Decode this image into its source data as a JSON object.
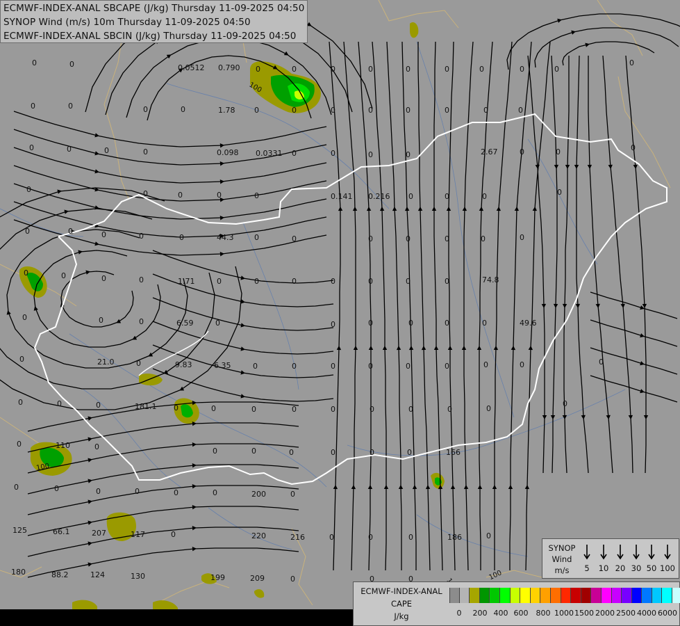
{
  "header": {
    "line1": "ECMWF-INDEX-ANAL SBCAPE (J/kg) Thursday 11-09-2025 04:50",
    "line2": "SYNOP Wind (m/s) 10m Thursday 11-09-2025 04:50",
    "line3": "ECMWF-INDEX-ANAL SBCIN (J/kg) Thursday 11-09-2025 04:50"
  },
  "synop_legend": {
    "title_line1": "SYNOP",
    "title_line2": "Wind",
    "title_line3": "m/s",
    "speeds": [
      "5",
      "10",
      "20",
      "30",
      "50",
      "100"
    ]
  },
  "cape_legend": {
    "title_line1": "ECMWF-INDEX-ANAL",
    "title_line2": "CAPE",
    "title_line3": "J/kg",
    "colors": [
      "#8c8c8c",
      "#b4b4b4",
      "#a6a600",
      "#009600",
      "#00c800",
      "#00ff00",
      "#c8ff00",
      "#ffff00",
      "#ffd200",
      "#ffa000",
      "#ff6e00",
      "#ff2800",
      "#c80000",
      "#a00000",
      "#c80096",
      "#ff00ff",
      "#c800ff",
      "#7800ff",
      "#0000ff",
      "#0078ff",
      "#00c8ff",
      "#00ffff",
      "#c8ffff",
      "#ffffff"
    ],
    "ticks": [
      "0",
      "200",
      "400",
      "600",
      "800",
      "1000",
      "1500",
      "2000",
      "2500",
      "4000",
      "6000"
    ]
  },
  "station_values": [
    {
      "text": "0"
    },
    {
      "text": "0"
    },
    {
      "text": "0"
    },
    {
      "text": "0.0512"
    },
    {
      "text": "0.790"
    },
    {
      "text": "0"
    },
    {
      "text": "0"
    },
    {
      "text": "0"
    },
    {
      "text": "0"
    },
    {
      "text": "0"
    },
    {
      "text": "0"
    },
    {
      "text": "0"
    },
    {
      "text": "0"
    },
    {
      "text": "0"
    },
    {
      "text": "0"
    },
    {
      "text": "0"
    },
    {
      "text": "0"
    },
    {
      "text": "1.78"
    },
    {
      "text": "0"
    },
    {
      "text": "0"
    },
    {
      "text": "0"
    },
    {
      "text": "0"
    },
    {
      "text": "0"
    },
    {
      "text": "0"
    },
    {
      "text": "0"
    },
    {
      "text": "0"
    },
    {
      "text": "0"
    },
    {
      "text": "0"
    },
    {
      "text": "0"
    },
    {
      "text": "0"
    },
    {
      "text": "0"
    },
    {
      "text": "0"
    },
    {
      "text": "0.098"
    },
    {
      "text": "0.0331"
    },
    {
      "text": "0"
    },
    {
      "text": "0"
    },
    {
      "text": "0"
    },
    {
      "text": "0"
    },
    {
      "text": "2.67"
    },
    {
      "text": "0"
    },
    {
      "text": "0"
    },
    {
      "text": "0"
    },
    {
      "text": "0"
    },
    {
      "text": "0"
    },
    {
      "text": "0"
    },
    {
      "text": "0"
    },
    {
      "text": "0"
    },
    {
      "text": "0.141"
    },
    {
      "text": "0.216"
    },
    {
      "text": "0"
    },
    {
      "text": "0"
    },
    {
      "text": "0"
    },
    {
      "text": "0"
    },
    {
      "text": "0"
    },
    {
      "text": "0"
    },
    {
      "text": "0"
    },
    {
      "text": "0"
    },
    {
      "text": "0"
    },
    {
      "text": "44.3"
    },
    {
      "text": "0"
    },
    {
      "text": "0"
    },
    {
      "text": "0"
    },
    {
      "text": "0"
    },
    {
      "text": "0"
    },
    {
      "text": "0"
    },
    {
      "text": "0"
    },
    {
      "text": "0"
    },
    {
      "text": "0"
    },
    {
      "text": "0"
    },
    {
      "text": "0"
    },
    {
      "text": "1.71"
    },
    {
      "text": "0"
    },
    {
      "text": "0"
    },
    {
      "text": "0"
    },
    {
      "text": "0"
    },
    {
      "text": "0"
    },
    {
      "text": "0"
    },
    {
      "text": "0"
    },
    {
      "text": "74.8"
    },
    {
      "text": "0"
    },
    {
      "text": "0"
    },
    {
      "text": "0"
    },
    {
      "text": "6.59"
    },
    {
      "text": "0"
    },
    {
      "text": "0"
    },
    {
      "text": "0"
    },
    {
      "text": "0"
    },
    {
      "text": "0"
    },
    {
      "text": "0"
    },
    {
      "text": "49.6"
    },
    {
      "text": "0"
    },
    {
      "text": "21.0"
    },
    {
      "text": "0"
    },
    {
      "text": "9.83"
    },
    {
      "text": "6.35"
    },
    {
      "text": "0"
    },
    {
      "text": "0"
    },
    {
      "text": "0"
    },
    {
      "text": "0"
    },
    {
      "text": "0"
    },
    {
      "text": "0"
    },
    {
      "text": "0"
    },
    {
      "text": "0"
    },
    {
      "text": "0"
    },
    {
      "text": "0"
    },
    {
      "text": "0"
    },
    {
      "text": "0"
    },
    {
      "text": "181.1"
    },
    {
      "text": "0"
    },
    {
      "text": "0"
    },
    {
      "text": "0"
    },
    {
      "text": "0"
    },
    {
      "text": "0"
    },
    {
      "text": "0"
    },
    {
      "text": "0"
    },
    {
      "text": "0"
    },
    {
      "text": "0"
    },
    {
      "text": "0"
    },
    {
      "text": "0"
    },
    {
      "text": "110"
    },
    {
      "text": "0"
    },
    {
      "text": "0"
    },
    {
      "text": "0"
    },
    {
      "text": "0"
    },
    {
      "text": "0"
    },
    {
      "text": "0"
    },
    {
      "text": "0"
    },
    {
      "text": "166"
    },
    {
      "text": "0"
    },
    {
      "text": "0"
    },
    {
      "text": "0"
    },
    {
      "text": "0"
    },
    {
      "text": "0"
    },
    {
      "text": "0"
    },
    {
      "text": "200"
    },
    {
      "text": "0"
    },
    {
      "text": "125"
    },
    {
      "text": "66.1"
    },
    {
      "text": "207"
    },
    {
      "text": "117"
    },
    {
      "text": "0"
    },
    {
      "text": "220"
    },
    {
      "text": "216"
    },
    {
      "text": "0"
    },
    {
      "text": "0"
    },
    {
      "text": "0"
    },
    {
      "text": "186"
    },
    {
      "text": "0"
    },
    {
      "text": "180"
    },
    {
      "text": "88.2"
    },
    {
      "text": "124"
    },
    {
      "text": "130"
    },
    {
      "text": "199"
    },
    {
      "text": "209"
    },
    {
      "text": "0"
    },
    {
      "text": "0"
    },
    {
      "text": "0"
    },
    {
      "text": "100"
    },
    {
      "text": "100"
    },
    {
      "text": "100"
    },
    {
      "text": "100"
    }
  ]
}
